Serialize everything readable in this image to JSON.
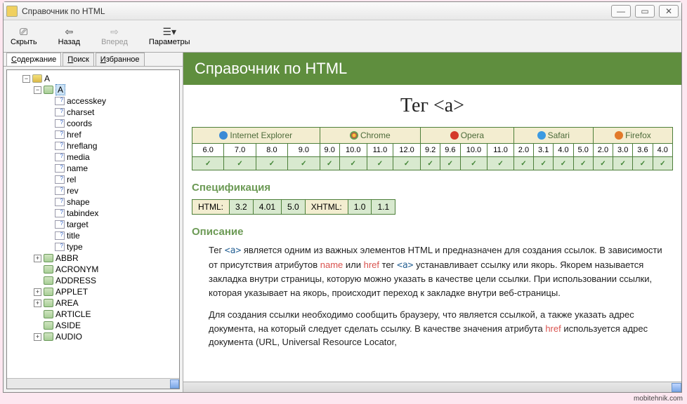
{
  "window": {
    "title": "Справочник по HTML"
  },
  "toolbar": {
    "hide": "Скрыть",
    "back": "Назад",
    "forward": "Вперед",
    "options": "Параметры"
  },
  "tabs": {
    "contents1": "С",
    "contents2": "одержание",
    "search1": "П",
    "search2": "оиск",
    "fav1": "И",
    "fav2": "збранное"
  },
  "tree": {
    "root": "A",
    "selected": "A",
    "attrs": [
      "accesskey",
      "charset",
      "coords",
      "href",
      "hreflang",
      "media",
      "name",
      "rel",
      "rev",
      "shape",
      "tabindex",
      "target",
      "title",
      "type"
    ],
    "tags": [
      "ABBR",
      "ACRONYM",
      "ADDRESS",
      "APPLET",
      "AREA",
      "ARTICLE",
      "ASIDE",
      "AUDIO"
    ],
    "expandable": {
      "ABBR": true,
      "APPLET": true,
      "AREA": true,
      "AUDIO": true
    }
  },
  "page": {
    "banner": "Справочник по HTML",
    "heading": "Тег <a>",
    "browsers": {
      "names": [
        "Internet Explorer",
        "Chrome",
        "Opera",
        "Safari",
        "Firefox"
      ],
      "versions": [
        [
          "6.0",
          "7.0",
          "8.0",
          "9.0"
        ],
        [
          "9.0",
          "10.0",
          "11.0",
          "12.0"
        ],
        [
          "9.2",
          "9.6",
          "10.0",
          "11.0"
        ],
        [
          "2.0",
          "3.1",
          "4.0",
          "5.0"
        ],
        [
          "2.0",
          "3.0",
          "3.6",
          "4.0"
        ]
      ]
    },
    "spec_h": "Спецификация",
    "spec_html_label": "HTML:",
    "spec_html_vals": [
      "3.2",
      "4.01",
      "5.0"
    ],
    "spec_xhtml_label": "XHTML:",
    "spec_xhtml_vals": [
      "1.0",
      "1.1"
    ],
    "desc_h": "Описание",
    "desc_p1_a": "Тег ",
    "desc_p1_code1": "<a>",
    "desc_p1_b": " является одним из важных элементов HTML и предназначен для создания ссылок. В зависимости от присутствия атрибутов ",
    "desc_p1_kw1": "name",
    "desc_p1_c": " или ",
    "desc_p1_kw2": "href",
    "desc_p1_d": " тег ",
    "desc_p1_code2": "<a>",
    "desc_p1_e": " устанавливает ссылку или якорь. Якорем называется закладка внутри страницы, которую можно указать в качестве цели ссылки. При использовании ссылки, которая указывает на якорь, происходит переход к закладке внутри веб-страницы.",
    "desc_p2_a": "Для создания ссылки необходимо сообщить браузеру, что является ссылкой, а также указать адрес документа, на который следует сделать ссылку. В качестве значения атрибута ",
    "desc_p2_kw": "href",
    "desc_p2_b": " используется адрес документа (URL, Universal Resource Locator,"
  },
  "watermark": "mobitehnik.com"
}
